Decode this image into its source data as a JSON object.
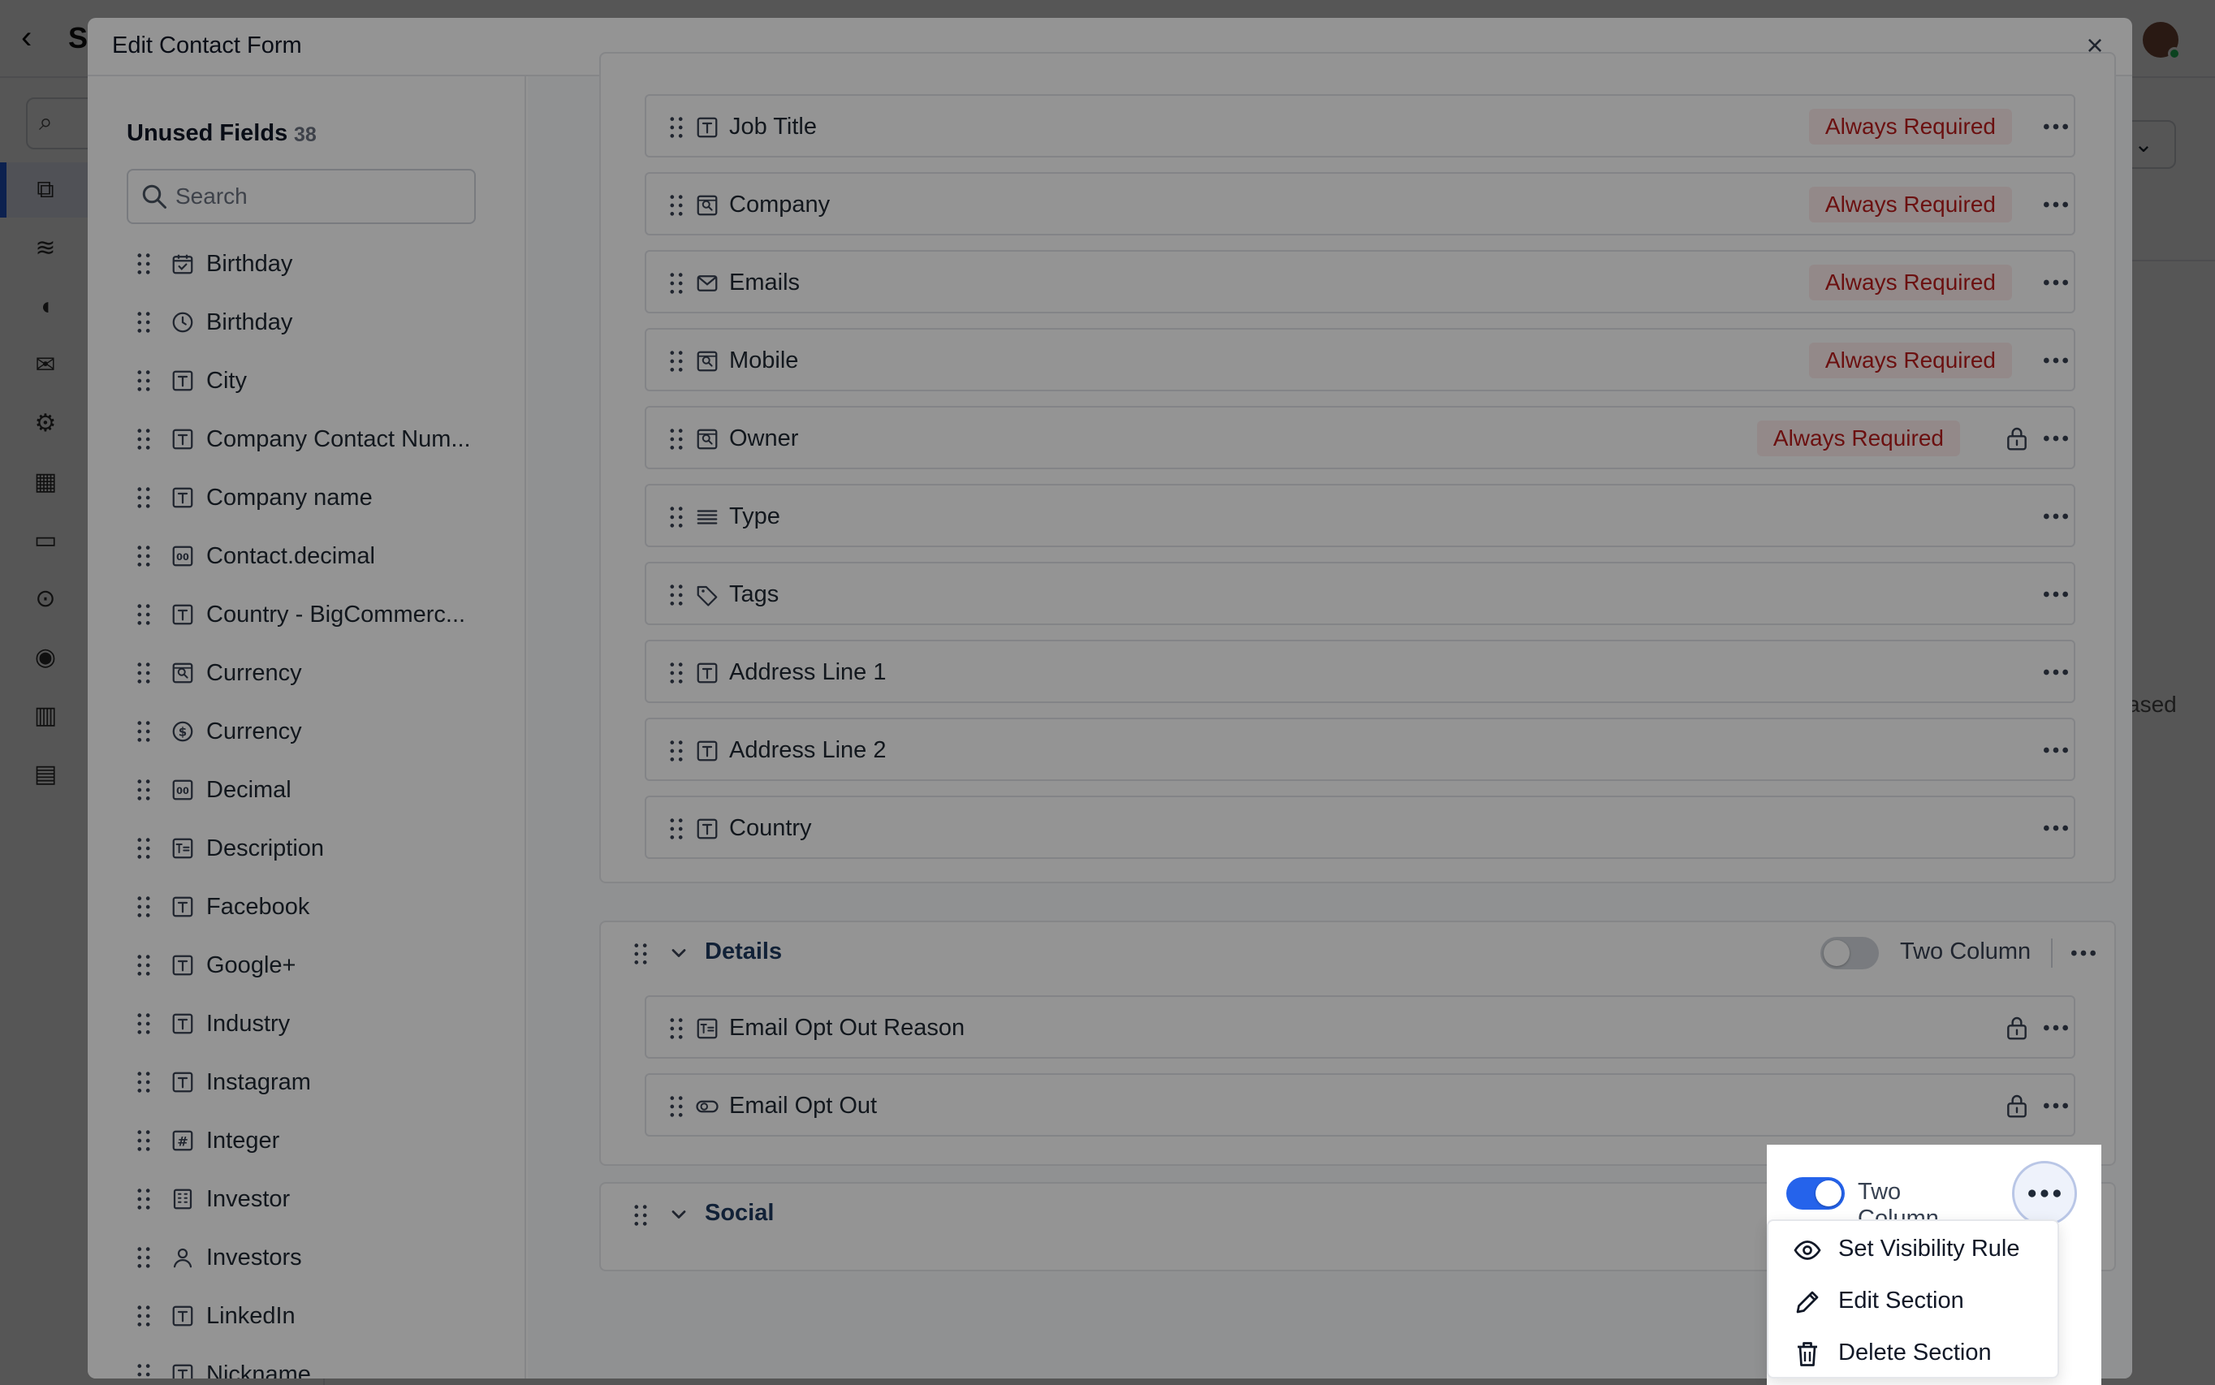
{
  "background": {
    "title_initial": "S",
    "right_text": "ased"
  },
  "modal": {
    "title": "Edit Contact Form",
    "close": "×"
  },
  "unused": {
    "title": "Unused Fields",
    "count": "38",
    "search_placeholder": "Search",
    "items": [
      {
        "label": "Birthday",
        "icon": "calendar-check"
      },
      {
        "label": "Birthday",
        "icon": "clock"
      },
      {
        "label": "City",
        "icon": "text"
      },
      {
        "label": "Company Contact Num...",
        "icon": "text"
      },
      {
        "label": "Company name",
        "icon": "text"
      },
      {
        "label": "Contact.decimal",
        "icon": "decimal"
      },
      {
        "label": "Country - BigCommerc...",
        "icon": "text"
      },
      {
        "label": "Currency",
        "icon": "lookup"
      },
      {
        "label": "Currency",
        "icon": "currency"
      },
      {
        "label": "Decimal",
        "icon": "decimal"
      },
      {
        "label": "Description",
        "icon": "textarea"
      },
      {
        "label": "Facebook",
        "icon": "text"
      },
      {
        "label": "Google+",
        "icon": "text"
      },
      {
        "label": "Industry",
        "icon": "text"
      },
      {
        "label": "Instagram",
        "icon": "text"
      },
      {
        "label": "Integer",
        "icon": "hash"
      },
      {
        "label": "Investor",
        "icon": "building"
      },
      {
        "label": "Investors",
        "icon": "person"
      },
      {
        "label": "LinkedIn",
        "icon": "text"
      },
      {
        "label": "Nickname",
        "icon": "text"
      }
    ]
  },
  "main_fields": [
    {
      "label": "Job Title",
      "icon": "text",
      "required": "Always Required",
      "lock": false
    },
    {
      "label": "Company",
      "icon": "lookup",
      "required": "Always Required",
      "lock": false
    },
    {
      "label": "Emails",
      "icon": "mail",
      "required": "Always Required",
      "lock": false
    },
    {
      "label": "Mobile",
      "icon": "lookup",
      "required": "Always Required",
      "lock": false
    },
    {
      "label": "Owner",
      "icon": "lookup",
      "required": "Always Required",
      "lock": true
    },
    {
      "label": "Type",
      "icon": "list",
      "required": "",
      "lock": false
    },
    {
      "label": "Tags",
      "icon": "tag",
      "required": "",
      "lock": false
    },
    {
      "label": "Address Line 1",
      "icon": "text",
      "required": "",
      "lock": false
    },
    {
      "label": "Address Line 2",
      "icon": "text",
      "required": "",
      "lock": false
    },
    {
      "label": "Country",
      "icon": "text",
      "required": "",
      "lock": false
    }
  ],
  "details": {
    "title": "Details",
    "two_column_label": "Two Column",
    "two_column_on": false,
    "fields": [
      {
        "label": "Email Opt Out Reason",
        "icon": "textarea",
        "lock": true
      },
      {
        "label": "Email Opt Out",
        "icon": "toggle",
        "lock": true
      }
    ]
  },
  "social": {
    "title": "Social",
    "two_column_label": "Two Column",
    "two_column_on": true
  },
  "menu": {
    "items": [
      {
        "label": "Set Visibility Rule",
        "icon": "eye-icon"
      },
      {
        "label": "Edit Section",
        "icon": "pencil-icon"
      },
      {
        "label": "Delete Section",
        "icon": "trash-icon"
      }
    ]
  },
  "colors": {
    "accent": "#2563eb",
    "required_bg": "#fdecec",
    "required_text": "#b91c1c",
    "section_title": "#1e3a5f"
  }
}
